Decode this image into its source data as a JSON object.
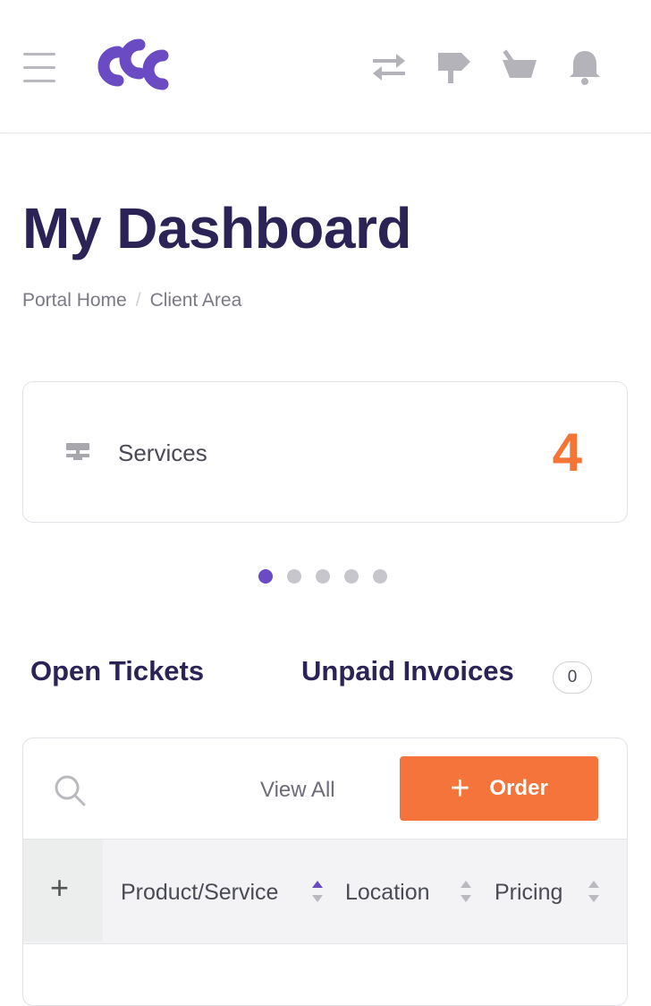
{
  "header": {
    "logo_alt": "ccc logo",
    "icons": [
      "transfer-icon",
      "signpost-icon",
      "basket-icon",
      "bell-icon"
    ]
  },
  "page": {
    "title": "My Dashboard",
    "breadcrumb": [
      "Portal Home",
      "Client Area"
    ]
  },
  "stats": {
    "label": "Services",
    "count": "4",
    "carousel_pages": 5,
    "active_page": 1
  },
  "tabs": {
    "open_tickets": "Open Tickets",
    "unpaid_invoices": "Unpaid Invoices",
    "unpaid_count": "0"
  },
  "services_panel": {
    "view_all": "View All",
    "order_label": "Order",
    "columns": [
      "Product/Service",
      "Location",
      "Pricing"
    ],
    "sorted_column": "Product/Service"
  },
  "colors": {
    "brand": "#6a4bc4",
    "accent": "#f47535",
    "heading": "#2b2355"
  }
}
